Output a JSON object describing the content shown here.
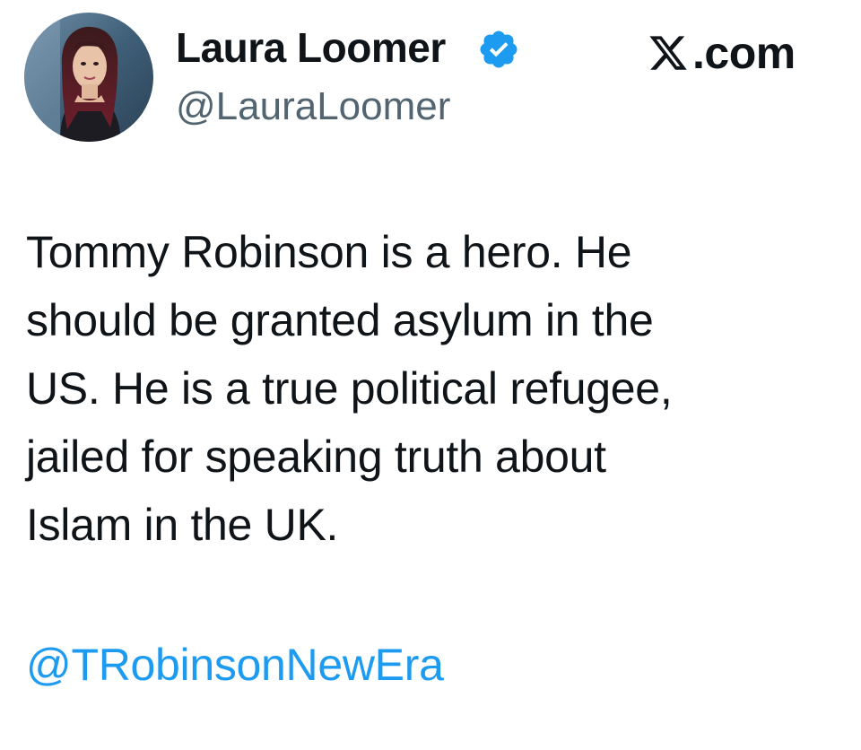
{
  "author": {
    "display_name": "Laura Loomer",
    "handle": "@LauraLoomer",
    "verified": true,
    "avatar_icon": "profile-photo"
  },
  "site": {
    "logo_icon": "x-logo-icon",
    "label": ".com"
  },
  "tweet": {
    "text": "Tommy Robinson is a hero. He\nshould be granted asylum in the\nUS. He is a true political refugee,\njailed for speaking truth about\nIslam in the UK.",
    "mention": "@TRobinsonNewEra"
  },
  "colors": {
    "text": "#0f1419",
    "secondary": "#536471",
    "link": "#1d9bf0",
    "verified": "#1d9bf0",
    "background": "#ffffff"
  }
}
